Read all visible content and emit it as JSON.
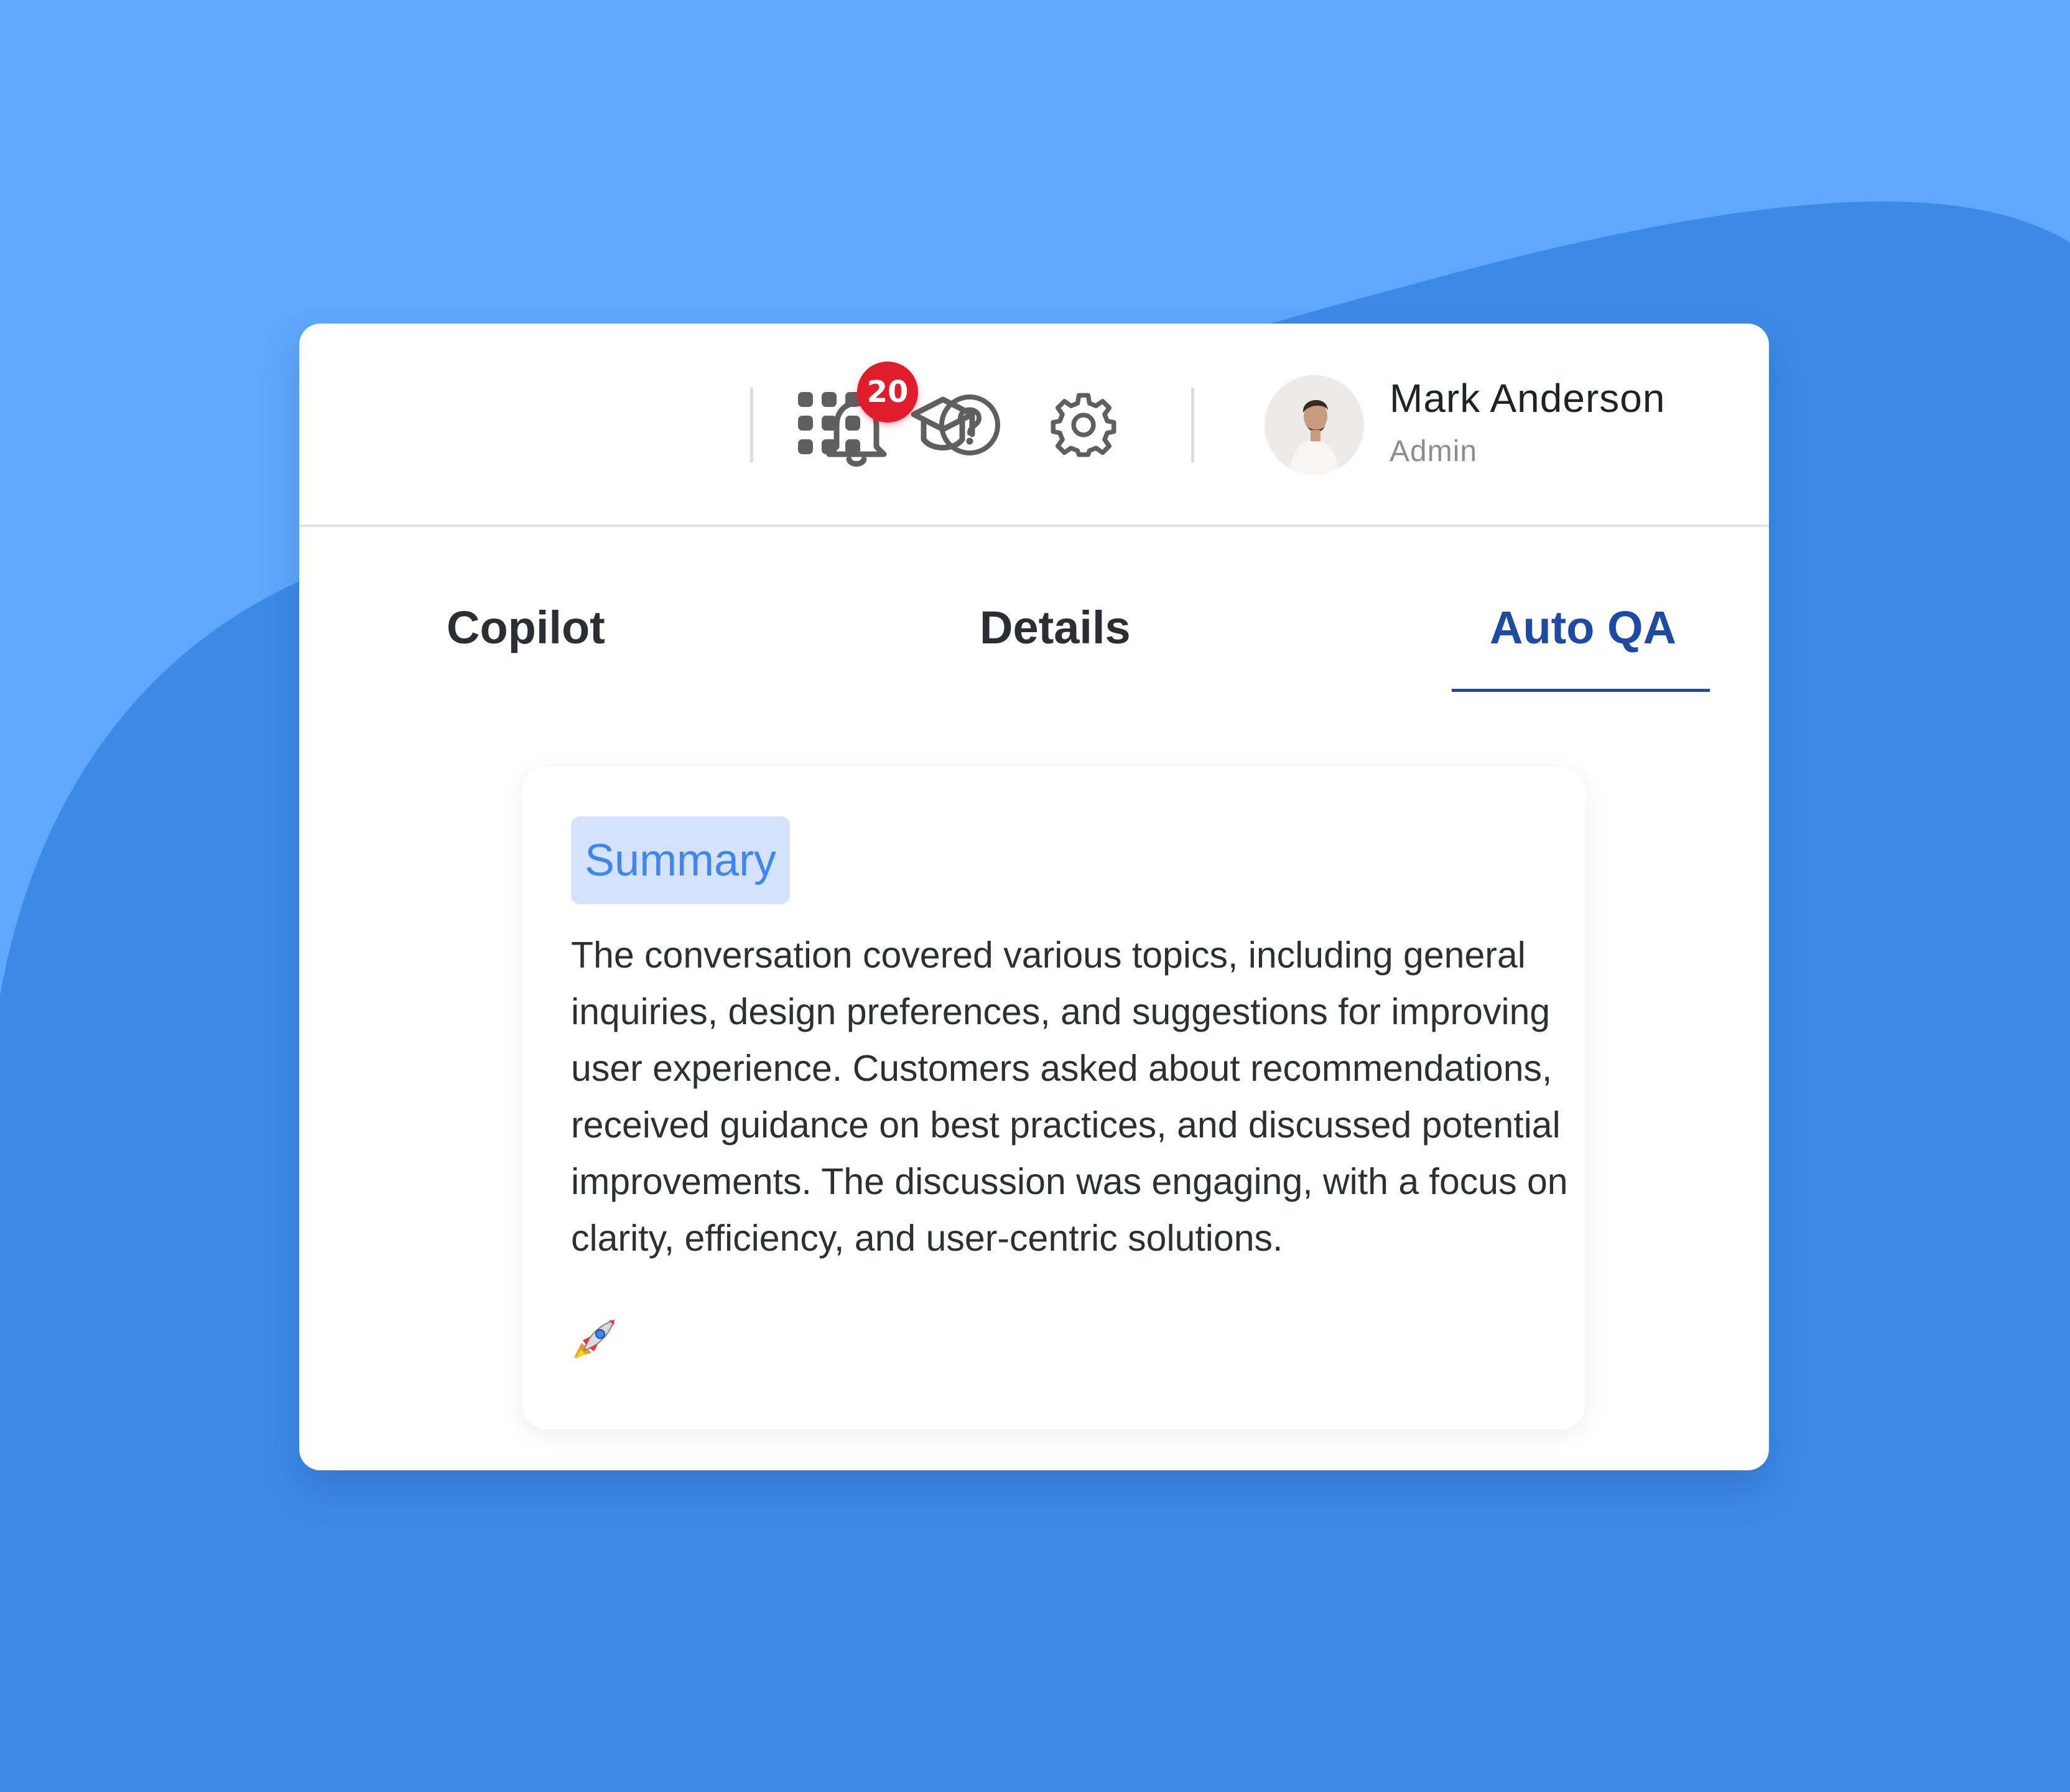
{
  "topbar": {
    "icons": [
      "apps-grid-icon",
      "graduation-cap-icon",
      "bell-icon",
      "help-icon",
      "gear-icon"
    ],
    "notifications_count": "20",
    "user": {
      "name": "Mark Anderson",
      "role": "Admin"
    }
  },
  "tabs": [
    {
      "label": "Copilot"
    },
    {
      "label": "Details"
    },
    {
      "label": "Auto QA",
      "active": true
    }
  ],
  "summary": {
    "badge_label": "Summary",
    "text": "The conversation covered various topics, including general inquiries, design preferences, and suggestions for improving user experience. Customers asked about recommendations, received guidance on best practices, and discussed potential improvements. The discussion was engaging, with a focus on clarity, efficiency, and user-centric solutions.",
    "trailing_icon": "rocket-icon"
  },
  "colors": {
    "background_light": "#5fa8fd",
    "background_dark": "#3d8ae6",
    "active_tab": "#1d4aa3",
    "badge_red": "#e01e2b",
    "summary_badge_bg": "#d4e2fd",
    "summary_badge_text": "#3e86f2"
  }
}
